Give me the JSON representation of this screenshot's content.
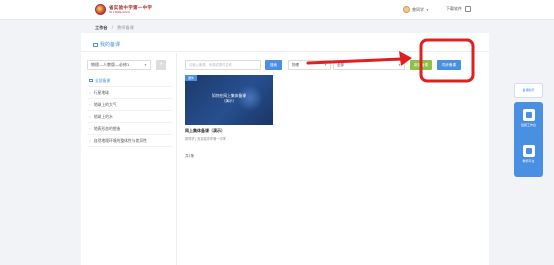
{
  "header": {
    "logo_cn": "省实验中学第一中学",
    "logo_en": "No.1 Middle School",
    "user_name": "曾同学",
    "download_label": "下载软件"
  },
  "breadcrumb": {
    "home": "工作台",
    "current": "教师备课"
  },
  "panel": {
    "title": "我的备课",
    "book_select": "物理—人教版—必修1",
    "add_label": "+",
    "tree": [
      {
        "label": "全部备课",
        "root": true
      },
      {
        "label": "行星地球",
        "root": false
      },
      {
        "label": "地球上的大气",
        "root": false
      },
      {
        "label": "地球上的水",
        "root": false
      },
      {
        "label": "地表形态的塑造",
        "root": false
      },
      {
        "label": "自然地理环境的整体性与差异性",
        "root": false
      }
    ],
    "search_placeholder": "请输入备课、资源或课件名称",
    "search_btn": "搜索",
    "filter1": "物理",
    "filter2": "全部",
    "btn_green": "新建备课",
    "btn_blue": "同步备课",
    "card": {
      "tag": "课件",
      "title": "如何在网上集体备课",
      "subtitle": "（演示）",
      "name": "网上集体备课（演示）",
      "meta": "曾同学 | 省实验中学第一中学"
    },
    "count_label": "共1条"
  },
  "float": {
    "top_label": "备课助手",
    "items": [
      {
        "label": "班级工作台"
      },
      {
        "label": "教师平台"
      }
    ]
  },
  "colors": {
    "accent": "#4a90e2",
    "green": "#8bc34a",
    "highlight": "#e02020"
  }
}
